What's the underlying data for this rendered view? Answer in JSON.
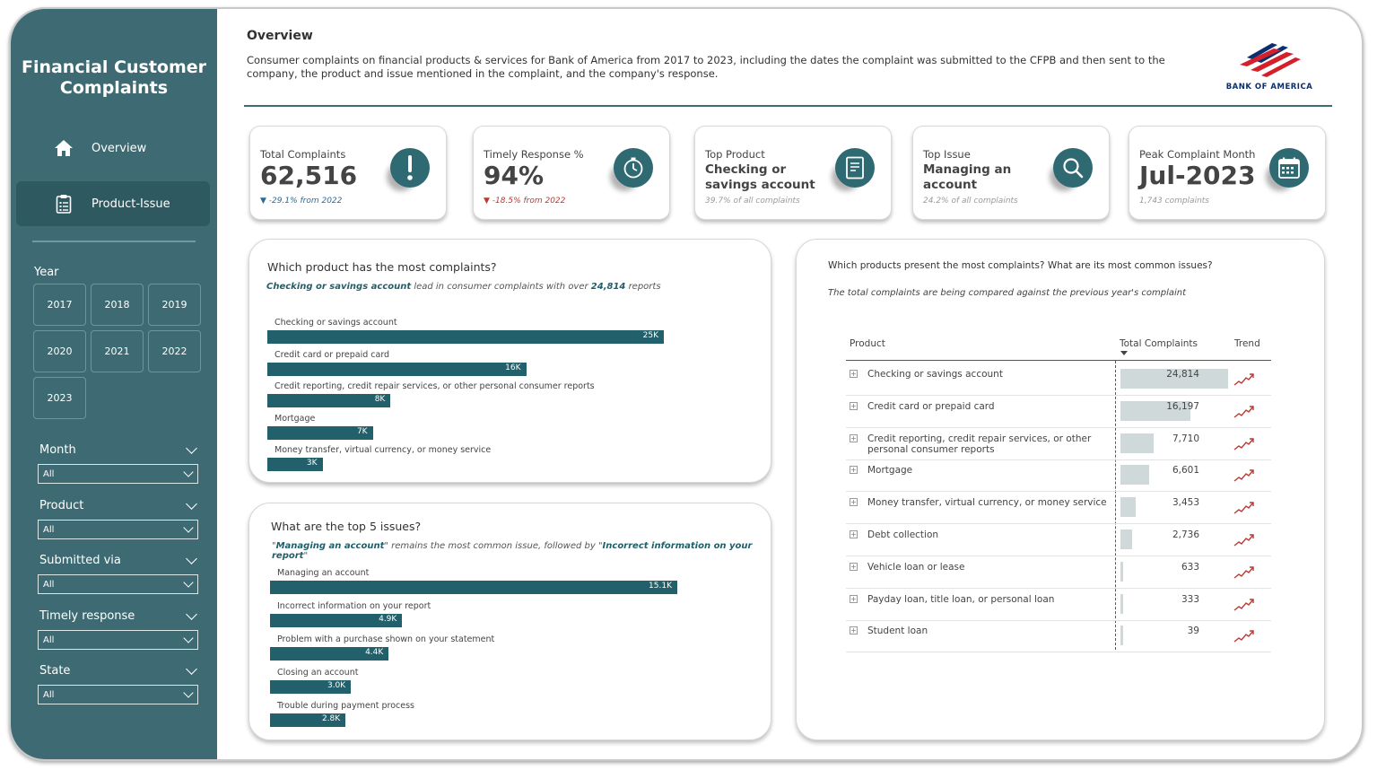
{
  "sidebar": {
    "title": "Financial Customer Complaints",
    "nav": [
      {
        "label": "Overview",
        "icon": "home-icon"
      },
      {
        "label": "Product-Issue",
        "icon": "clipboard-icon"
      }
    ],
    "year_label": "Year",
    "years": [
      "2017",
      "2018",
      "2019",
      "2020",
      "2021",
      "2022",
      "2023"
    ],
    "filters": [
      {
        "label": "Month",
        "value": "All"
      },
      {
        "label": "Product",
        "value": "All"
      },
      {
        "label": "Submitted via",
        "value": "All"
      },
      {
        "label": "Timely response",
        "value": "All"
      },
      {
        "label": "State",
        "value": "All"
      }
    ]
  },
  "header": {
    "title": "Overview",
    "description": "Consumer complaints on financial products & services for Bank of America from 2017 to 2023, including the dates the complaint was submitted to the CFPB and then sent to the company, the product and issue mentioned in the complaint, and the company's response.",
    "logo_text": "BANK OF AMERICA"
  },
  "kpis": [
    {
      "label": "Total Complaints",
      "value": "62,516",
      "sub": "▼ -29.1% from 2022",
      "icon": "exclamation-icon"
    },
    {
      "label": "Timely Response %",
      "value": "94%",
      "sub": "▼ -18.5% from 2022",
      "icon": "stopwatch-icon"
    },
    {
      "label": "Top Product",
      "value": "Checking or savings account",
      "sub": "39.7% of all complaints",
      "icon": "document-icon"
    },
    {
      "label": "Top Issue",
      "value": "Managing an account",
      "sub": "24.2% of all complaints",
      "icon": "search-icon"
    },
    {
      "label": "Peak Complaint Month",
      "value": "Jul-2023",
      "sub": "1,743 complaints",
      "icon": "calendar-icon"
    }
  ],
  "products_card": {
    "title": "Which product has the most complaints?",
    "sub_bold1": "Checking or savings account",
    "sub_mid": " lead in consumer complaints with over ",
    "sub_bold2": "24,814",
    "sub_end": " reports"
  },
  "issues_card": {
    "title": "What are the top 5 issues?",
    "sub_q1": "\"",
    "sub_bold1": "Managing an account",
    "sub_mid": "\" remains the most common issue, followed by  \"",
    "sub_bold2": "Incorrect information on your report",
    "sub_q2": "\""
  },
  "table_card": {
    "title": "Which products present the most complaints? What are its most common issues?",
    "subtitle": "The total complaints are being compared against the previous year's complaint",
    "col_product": "Product",
    "col_total": "Total Complaints",
    "col_trend": "Trend",
    "rows": [
      {
        "name": "Checking or savings account",
        "value": "24,814",
        "num": 24814
      },
      {
        "name": "Credit card or prepaid card",
        "value": "16,197",
        "num": 16197
      },
      {
        "name": "Credit reporting, credit repair services, or other personal consumer reports",
        "value": "7,710",
        "num": 7710
      },
      {
        "name": "Mortgage",
        "value": "6,601",
        "num": 6601
      },
      {
        "name": "Money transfer, virtual currency, or money service",
        "value": "3,453",
        "num": 3453
      },
      {
        "name": "Debt collection",
        "value": "2,736",
        "num": 2736
      },
      {
        "name": "Vehicle loan or lease",
        "value": "633",
        "num": 633
      },
      {
        "name": "Payday loan, title loan, or personal loan",
        "value": "333",
        "num": 333
      },
      {
        "name": "Student loan",
        "value": "39",
        "num": 39
      }
    ]
  },
  "chart_data": [
    {
      "type": "bar",
      "orientation": "horizontal",
      "title": "Which product has the most complaints?",
      "categories": [
        "Checking or savings account",
        "Credit card or prepaid card",
        "Credit reporting, credit repair services, or other personal consumer reports",
        "Mortgage",
        "Money transfer, virtual currency, or money service"
      ],
      "values": [
        24814,
        16197,
        7710,
        6601,
        3453
      ],
      "data_labels": [
        "25K",
        "16K",
        "8K",
        "7K",
        "3K"
      ]
    },
    {
      "type": "bar",
      "orientation": "horizontal",
      "title": "What are the top 5 issues?",
      "categories": [
        "Managing an account",
        "Incorrect information on your report",
        "Problem with a purchase shown on your statement",
        "Closing an account",
        "Trouble during payment process"
      ],
      "values": [
        15100,
        4900,
        4400,
        3000,
        2800
      ],
      "data_labels": [
        "15.1K",
        "4.9K",
        "4.4K",
        "3.0K",
        "2.8K"
      ]
    }
  ],
  "colors": {
    "sidebar": "#3e6b73",
    "bar": "#22606b",
    "table_bar": "#cfd9da",
    "trend": "#b93a32"
  }
}
